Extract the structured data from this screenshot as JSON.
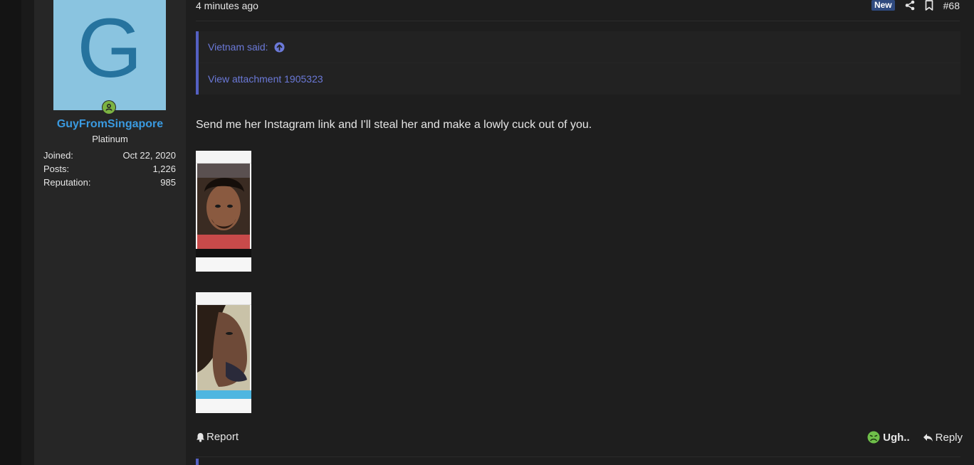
{
  "user": {
    "avatar_letter": "G",
    "username": "GuyFromSingapore",
    "title": "Platinum",
    "stats": [
      {
        "label": "Joined:",
        "value": "Oct 22, 2020"
      },
      {
        "label": "Posts:",
        "value": "1,226"
      },
      {
        "label": "Reputation:",
        "value": "985"
      }
    ]
  },
  "post": {
    "time": "4 minutes ago",
    "new_badge": "New",
    "number": "#68",
    "quote": {
      "author": "Vietnam said:",
      "body": "View attachment 1905323"
    },
    "text": "Send me her Instagram link and I'll steal her and make a lowly cuck out of you.",
    "footer": {
      "report_label": "Report",
      "reaction_label": "Ugh..",
      "reply_label": "Reply"
    }
  },
  "colors": {
    "accent": "#5460c2",
    "username": "#3a9ae0",
    "online": "#7cb342",
    "new_badge": "#2f4a7e",
    "reaction": "#6fbf4a"
  },
  "icons": {
    "online": "user-online-icon",
    "quote_jump": "arrow-up-circle-icon",
    "share": "share-icon",
    "bookmark": "bookmark-icon",
    "report": "bell-icon",
    "reaction": "sick-face-icon",
    "reply": "reply-arrow-icon"
  }
}
